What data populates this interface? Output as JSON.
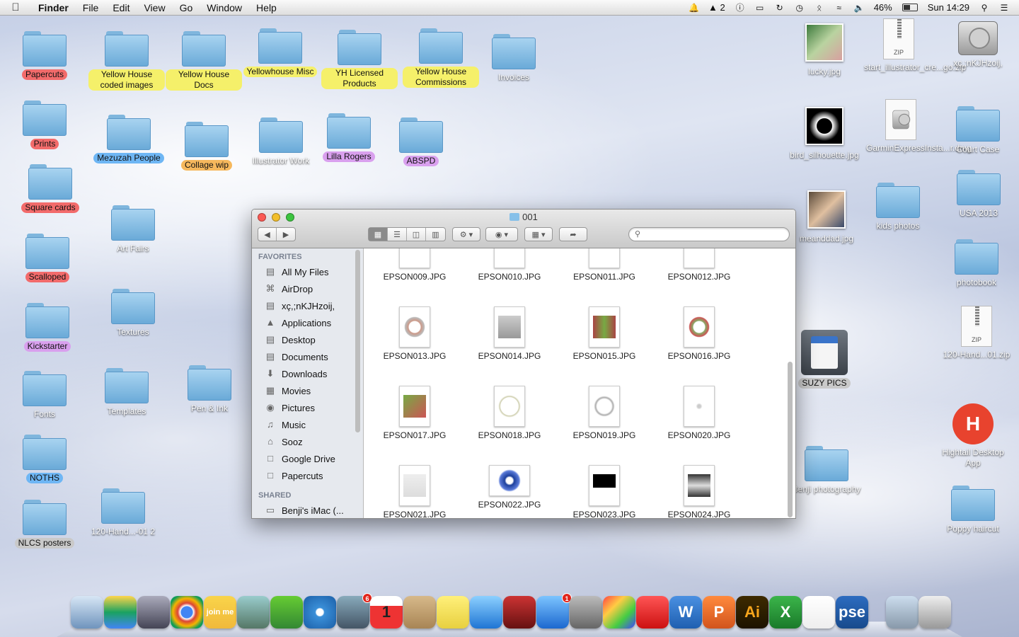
{
  "menubar": {
    "app_name": "Finder",
    "menus": [
      "File",
      "Edit",
      "View",
      "Go",
      "Window",
      "Help"
    ],
    "status": {
      "notifications_badge": "2",
      "battery": "46%",
      "clock": "Sun 14:29"
    }
  },
  "desktop": {
    "left_items": [
      {
        "label": "Papercuts",
        "tag": "red"
      },
      {
        "label": "Yellow House coded images",
        "tag": "yellow"
      },
      {
        "label": "Yellow House Docs",
        "tag": "yellow"
      },
      {
        "label": "Yellowhouse Misc",
        "tag": "yellow"
      },
      {
        "label": "YH Licensed Products",
        "tag": "yellow"
      },
      {
        "label": "Yellow House Commissions",
        "tag": "yellow"
      },
      {
        "label": "Invoices",
        "tag": ""
      },
      {
        "label": "Prints",
        "tag": "red"
      },
      {
        "label": "Mezuzah People",
        "tag": "blue"
      },
      {
        "label": "Collage wip",
        "tag": "orange"
      },
      {
        "label": "Illustrator Work",
        "tag": ""
      },
      {
        "label": "Lilla Rogers",
        "tag": "purple"
      },
      {
        "label": "ABSPD",
        "tag": "purple"
      },
      {
        "label": "Square cards",
        "tag": "red"
      },
      {
        "label": "Art Fairs",
        "tag": ""
      },
      {
        "label": "Scalloped",
        "tag": "red"
      },
      {
        "label": "Textures",
        "tag": ""
      },
      {
        "label": "Kickstarter",
        "tag": "purple"
      },
      {
        "label": "Fonts",
        "tag": ""
      },
      {
        "label": "Templates",
        "tag": ""
      },
      {
        "label": "Pen & Ink",
        "tag": ""
      },
      {
        "label": "NOTHS",
        "tag": "blue"
      },
      {
        "label": "NLCS posters",
        "tag": "gray"
      },
      {
        "label": "120-Hand...-01 2",
        "tag": ""
      }
    ],
    "right_items": [
      {
        "label": "lucky.jpg",
        "kind": "image"
      },
      {
        "label": "start_illustrator_cre...go.zip",
        "kind": "zip"
      },
      {
        "label": "xç,;nKJHzoij,",
        "kind": "disk"
      },
      {
        "label": "bird_silhouette.jpg",
        "kind": "image"
      },
      {
        "label": "GarminExpressInsta...r.dmg",
        "kind": "dmg"
      },
      {
        "label": "Court Case",
        "kind": "folder"
      },
      {
        "label": "meanddad.jpg",
        "kind": "image"
      },
      {
        "label": "kids photos",
        "kind": "folder"
      },
      {
        "label": "USA 2013",
        "kind": "folder"
      },
      {
        "label": "photobook",
        "kind": "folder"
      },
      {
        "label": "120-Hand...01.zip",
        "kind": "zip"
      },
      {
        "label": "SUZY PICS",
        "kind": "sd",
        "tag": "gray"
      },
      {
        "label": "Hightail Desktop App",
        "kind": "app"
      },
      {
        "label": "Benji photography",
        "kind": "folder"
      },
      {
        "label": "Poppy haircut",
        "kind": "folder"
      }
    ],
    "zip_caption": "ZIP"
  },
  "finder": {
    "title": "001",
    "search_placeholder": "",
    "sidebar": {
      "favorites_header": "FAVORITES",
      "favorites": [
        {
          "label": "All My Files",
          "icon": "all-files-icon"
        },
        {
          "label": "AirDrop",
          "icon": "airdrop-icon"
        },
        {
          "label": "xç,;nKJHzoij,",
          "icon": "disk-icon"
        },
        {
          "label": "Applications",
          "icon": "applications-icon"
        },
        {
          "label": "Desktop",
          "icon": "desktop-icon"
        },
        {
          "label": "Documents",
          "icon": "documents-icon"
        },
        {
          "label": "Downloads",
          "icon": "downloads-icon"
        },
        {
          "label": "Movies",
          "icon": "movies-icon"
        },
        {
          "label": "Pictures",
          "icon": "pictures-icon"
        },
        {
          "label": "Music",
          "icon": "music-icon"
        },
        {
          "label": "Sooz",
          "icon": "home-icon"
        },
        {
          "label": "Google Drive",
          "icon": "folder-icon"
        },
        {
          "label": "Papercuts",
          "icon": "folder-icon"
        }
      ],
      "shared_header": "SHARED",
      "shared": [
        {
          "label": "Benji's iMac (...",
          "icon": "imac-icon"
        }
      ]
    },
    "files": [
      "EPSON009.JPG",
      "EPSON010.JPG",
      "EPSON011.JPG",
      "EPSON012.JPG",
      "EPSON013.JPG",
      "EPSON014.JPG",
      "EPSON015.JPG",
      "EPSON016.JPG",
      "EPSON017.JPG",
      "EPSON018.JPG",
      "EPSON019.JPG",
      "EPSON020.JPG",
      "EPSON021.JPG",
      "EPSON022.JPG",
      "EPSON023.JPG",
      "EPSON024.JPG"
    ]
  },
  "dock": {
    "apps": [
      {
        "name": "Finder"
      },
      {
        "name": "Google Drive"
      },
      {
        "name": "Launchpad"
      },
      {
        "name": "Chrome"
      },
      {
        "name": "join.me",
        "text": "join me"
      },
      {
        "name": "Game"
      },
      {
        "name": "Frogger"
      },
      {
        "name": "Safari"
      },
      {
        "name": "Mail",
        "badge": "6"
      },
      {
        "name": "Calendar",
        "text": "1"
      },
      {
        "name": "Contacts"
      },
      {
        "name": "Stickies"
      },
      {
        "name": "iTunes"
      },
      {
        "name": "Photo Booth"
      },
      {
        "name": "App Store",
        "badge": "1"
      },
      {
        "name": "System Preferences"
      },
      {
        "name": "Color Picker"
      },
      {
        "name": "SketchBook Pro"
      },
      {
        "name": "Word",
        "text": "W"
      },
      {
        "name": "PowerPoint",
        "text": "P"
      },
      {
        "name": "Illustrator",
        "text": "Ai"
      },
      {
        "name": "Excel",
        "text": "X"
      },
      {
        "name": "Acrobat"
      },
      {
        "name": "Photoshop Elements",
        "text": "pse"
      },
      {
        "name": "Preview"
      },
      {
        "name": "Trash"
      }
    ]
  }
}
